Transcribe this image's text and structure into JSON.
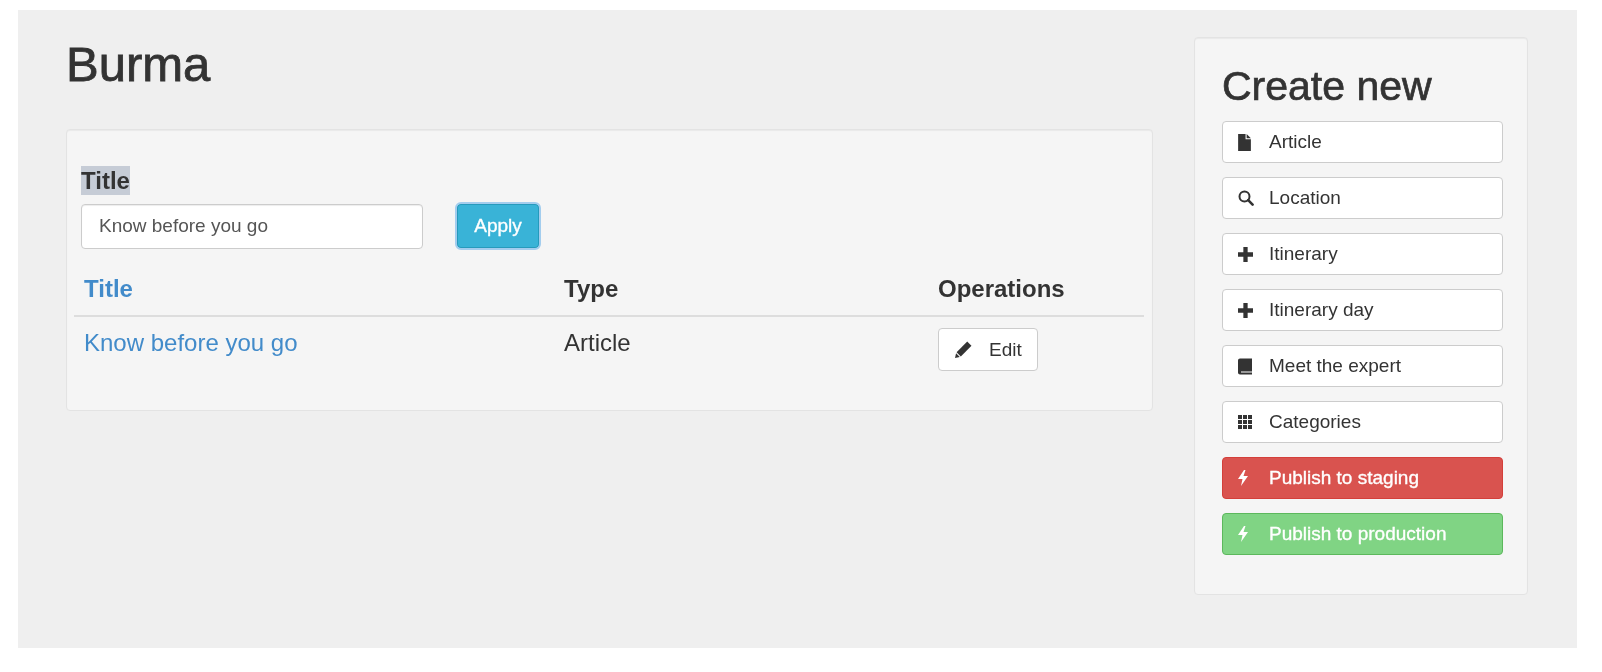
{
  "page": {
    "title": "Burma"
  },
  "filter": {
    "label": "Title",
    "label_highlighted": true,
    "value": "Know before you go",
    "button": {
      "label": "Apply",
      "focused": true
    }
  },
  "table": {
    "columns": [
      {
        "label": "Title",
        "sortable": true
      },
      {
        "label": "Type",
        "sortable": false
      },
      {
        "label": "Operations",
        "sortable": false
      }
    ],
    "rows": [
      {
        "title": "Know before you go",
        "type": "Article",
        "operation": "Edit"
      }
    ]
  },
  "sidebar": {
    "title": "Create new",
    "buttons": [
      {
        "label": "Article",
        "kind": "default"
      },
      {
        "label": "Location",
        "kind": "default"
      },
      {
        "label": "Itinerary",
        "kind": "default"
      },
      {
        "label": "Itinerary day",
        "kind": "default"
      },
      {
        "label": "Meet the expert",
        "kind": "default"
      },
      {
        "label": "Categories",
        "kind": "default"
      },
      {
        "label": "Publish to staging",
        "kind": "danger"
      },
      {
        "label": "Publish to production",
        "kind": "success"
      }
    ]
  }
}
